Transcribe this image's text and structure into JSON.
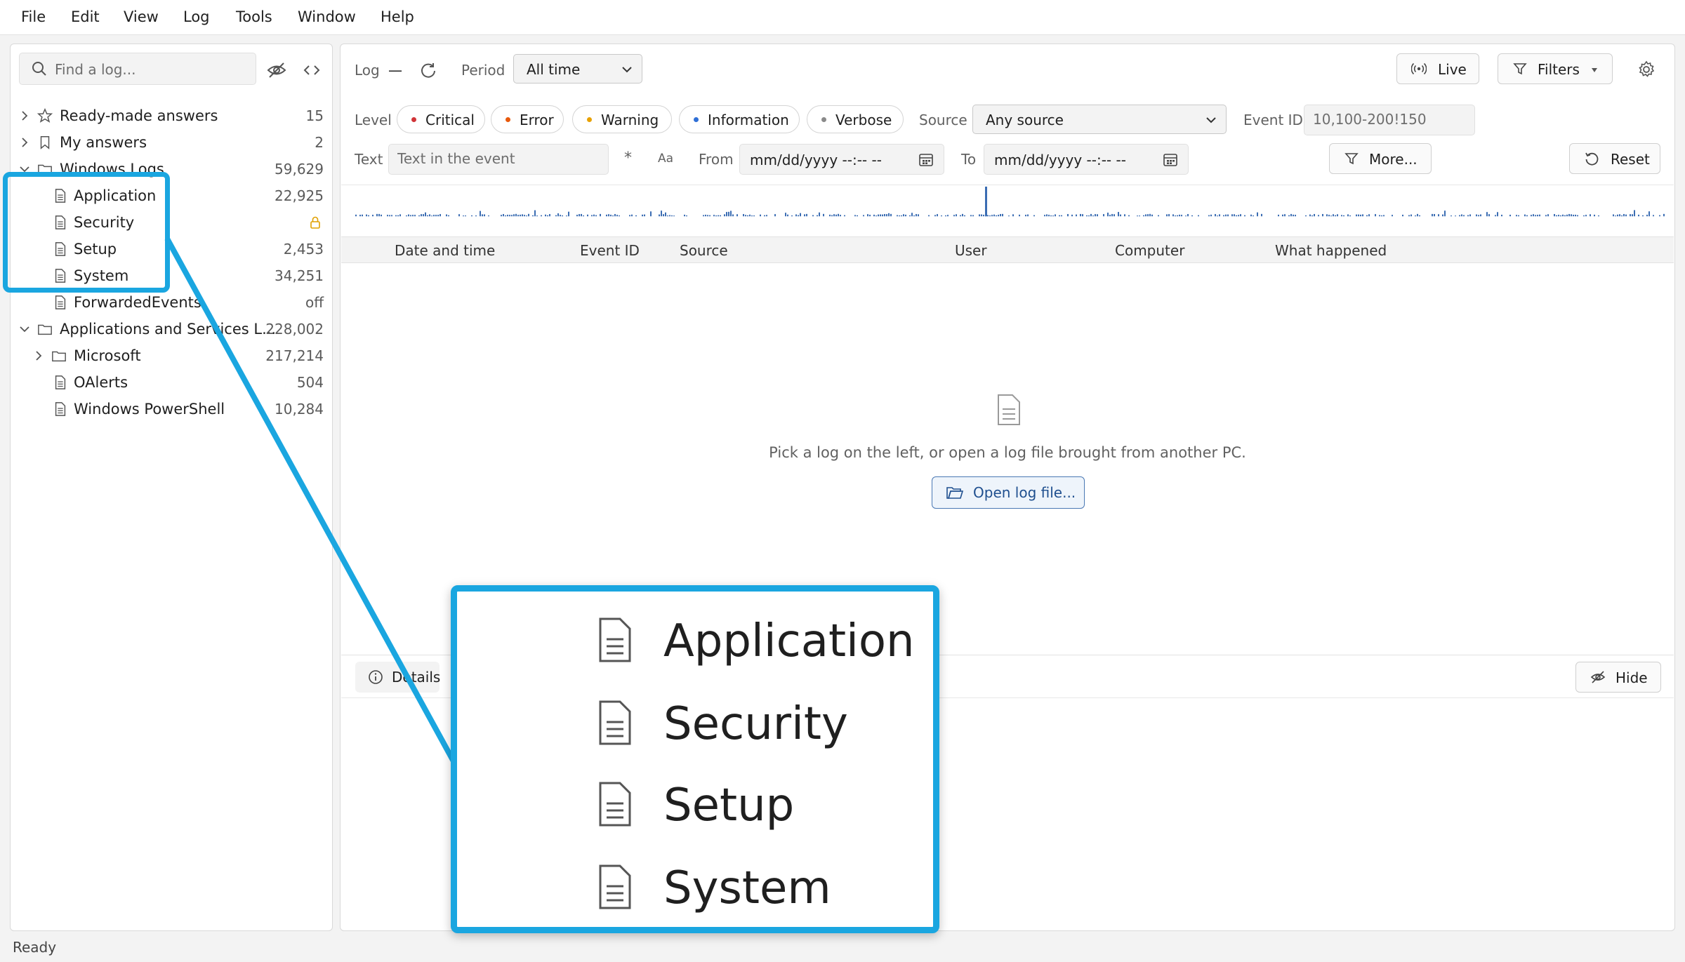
{
  "menu": [
    "File",
    "Edit",
    "View",
    "Log",
    "Tools",
    "Window",
    "Help"
  ],
  "sidebar": {
    "search_placeholder": "Find a log...",
    "items": [
      {
        "label": "Ready-made answers",
        "count": "15"
      },
      {
        "label": "My answers",
        "count": "2"
      },
      {
        "label": "Windows Logs",
        "count": "59,629"
      },
      {
        "label": "Application",
        "count": "22,925"
      },
      {
        "label": "Security",
        "count": ""
      },
      {
        "label": "Setup",
        "count": "2,453"
      },
      {
        "label": "System",
        "count": "34,251"
      },
      {
        "label": "ForwardedEvents",
        "count": "off"
      },
      {
        "label": "Applications and Services L...",
        "count": "228,002"
      },
      {
        "label": "Microsoft",
        "count": "217,214"
      },
      {
        "label": "OAlerts",
        "count": "504"
      },
      {
        "label": "Windows PowerShell",
        "count": "10,284"
      }
    ]
  },
  "toolbar": {
    "log_label": "Log",
    "log_value": "—",
    "period_label": "Period",
    "period_value": "All time",
    "live_label": "Live",
    "filters_label": "Filters"
  },
  "filters": {
    "level_label": "Level",
    "levels": [
      {
        "label": "Critical",
        "color": "#d13438"
      },
      {
        "label": "Error",
        "color": "#e8590c"
      },
      {
        "label": "Warning",
        "color": "#e8a100"
      },
      {
        "label": "Information",
        "color": "#2f6fd6"
      },
      {
        "label": "Verbose",
        "color": "#8a8a8a"
      }
    ],
    "source_label": "Source",
    "source_value": "Any source",
    "eventid_label": "Event ID",
    "eventid_placeholder": "10,100-200!150",
    "text_label": "Text",
    "text_placeholder": "Text in the event",
    "regex_glyph": "*",
    "case_glyph": "Aa",
    "from_label": "From",
    "from_value": "mm/dd/yyyy --:-- --",
    "to_label": "To",
    "to_value": "mm/dd/yyyy --:-- --",
    "more_label": "More...",
    "reset_label": "Reset"
  },
  "table": {
    "columns": [
      "Date and time",
      "Event ID",
      "Source",
      "User",
      "Computer",
      "What happened"
    ]
  },
  "empty_state": {
    "message": "Pick a log on the left, or open a log file brought from another PC.",
    "open_label": "Open log file..."
  },
  "details": {
    "tab_label": "Details",
    "hide_label": "Hide"
  },
  "status": "Ready",
  "callout": {
    "items": [
      "Application",
      "Security",
      "Setup",
      "System"
    ],
    "color": "#1aa6e0"
  }
}
